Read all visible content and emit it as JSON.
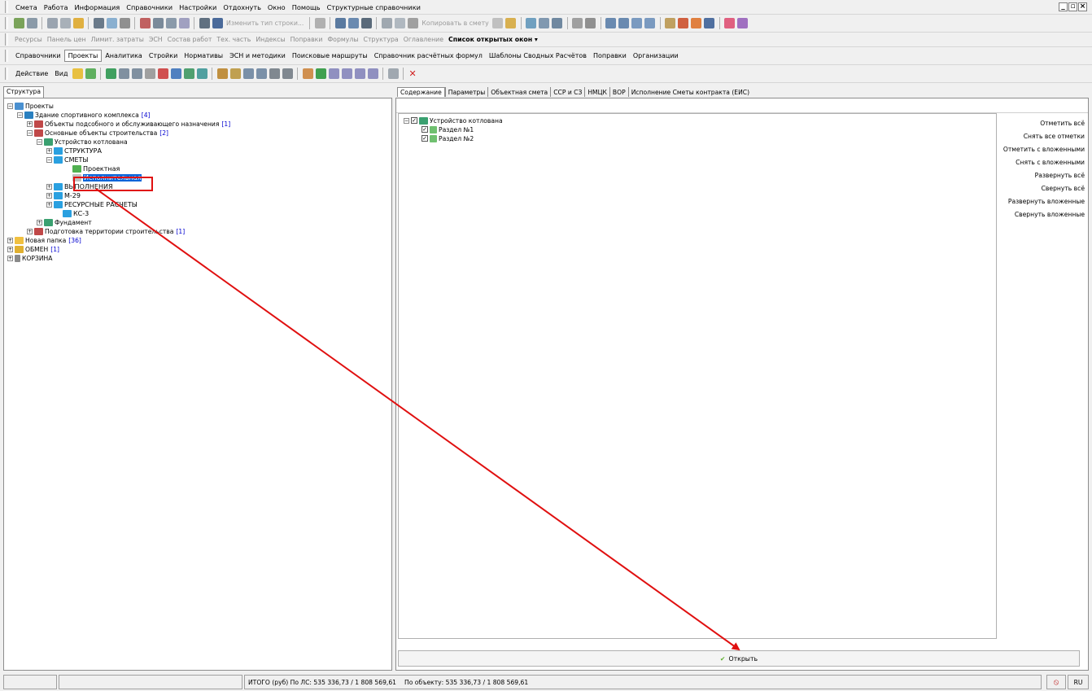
{
  "menu": [
    "Смета",
    "Работа",
    "Информация",
    "Справочники",
    "Настройки",
    "Отдохнуть",
    "Окно",
    "Помощь",
    "Структурные справочники"
  ],
  "toolbar1": {
    "change_row_type": "Изменить тип строки...",
    "copy_to_estimate": "Копировать в смету"
  },
  "panels_bar": {
    "items": [
      "Ресурсы",
      "Панель цен",
      "Лимит. затраты",
      "ЭСН",
      "Состав работ",
      "Тех. часть",
      "Индексы",
      "Поправки",
      "Формулы",
      "Структура",
      "Оглавление"
    ],
    "open_windows": "Список открытых окон ▾"
  },
  "nav_tabs": [
    "Справочники",
    "Проекты",
    "Аналитика",
    "Стройки",
    "Нормативы",
    "ЭСН и методики",
    "Поисковые маршруты",
    "Справочник расчётных формул",
    "Шаблоны Сводных Расчётов",
    "Поправки",
    "Организации"
  ],
  "nav_active": "Проекты",
  "action_bar": {
    "action": "Действие",
    "view": "Вид"
  },
  "left_tab": "Структура",
  "tree": {
    "root": "Проекты",
    "sport": "Здание спортивного комплекса",
    "sport_count": "[4]",
    "aux": "Объекты подсобного и обслуживающего назначения",
    "aux_count": "[1]",
    "main": "Основные объекты строительства",
    "main_count": "[2]",
    "pit": "Устройство котлована",
    "structure": "СТРУКТУРА",
    "estimates": "СМЕТЫ",
    "design": "Проектная",
    "executive": "Исполнительная",
    "execution": "ВЫПОЛНЕНИЯ",
    "m29": "М-29",
    "resources": "РЕСУРСНЫЕ РАСЧЕТЫ",
    "ks3": "КС-3",
    "foundation": "Фундамент",
    "prep": "Подготовка территории строительства",
    "prep_count": "[1]",
    "new_folder": "Новая папка",
    "new_folder_count": "[36]",
    "exchange": "ОБМЕН",
    "exchange_count": "[1]",
    "trash": "КОРЗИНА"
  },
  "right_tabs": [
    "Содержание",
    "Параметры",
    "Объектная смета",
    "ССР и СЗ",
    "НМЦК",
    "ВОР",
    "Исполнение Сметы контракта (ЕИС)"
  ],
  "right_active": "Содержание",
  "content_tree": {
    "root": "Устройство котлована",
    "sec1": "Раздел №1",
    "sec2": "Раздел №2"
  },
  "side_buttons": [
    "Отметить всё",
    "Снять все отметки",
    "Отметить с вложенными",
    "Снять с вложенными",
    "Развернуть всё",
    "Свернуть всё",
    "Развернуть вложенные",
    "Свернуть вложенные"
  ],
  "open_button": "Открыть",
  "status": {
    "total": "ИТОГО (руб)  По ЛС: 535 336,73 / 1 808 569,61",
    "object": "По объекту: 535 336,73 / 1 808 569,61",
    "lang": "RU"
  },
  "colors": {
    "selection": "#0a64d8",
    "highlight_box": "#e01010",
    "arrow": "#e01010",
    "folder": "#2aa0e0"
  }
}
